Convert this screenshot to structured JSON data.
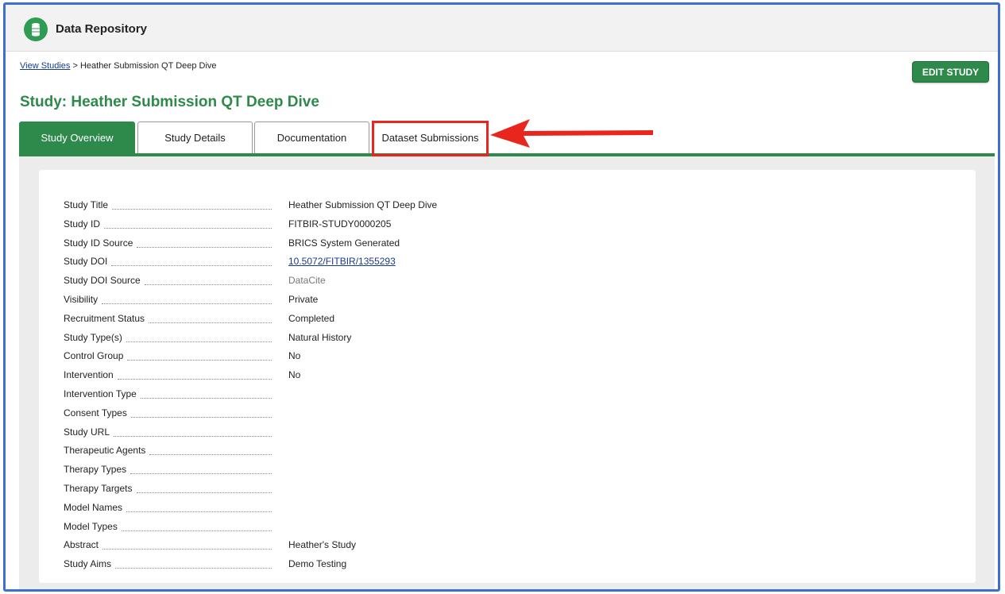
{
  "app": {
    "title": "Data Repository"
  },
  "breadcrumb": {
    "link": "View Studies",
    "separator": ">",
    "current": "Heather Submission QT Deep Dive"
  },
  "actions": {
    "edit_label": "EDIT STUDY"
  },
  "page": {
    "title": "Study: Heather Submission QT Deep Dive"
  },
  "tabs": [
    {
      "label": "Study Overview",
      "active": true
    },
    {
      "label": "Study Details",
      "active": false
    },
    {
      "label": "Documentation",
      "active": false
    },
    {
      "label": "Dataset Submissions",
      "active": false
    }
  ],
  "annotation": {
    "highlight_color": "#e8261d",
    "target": "Dataset Submissions"
  },
  "colors": {
    "accent": "#2e8a4b",
    "link": "#1a3a8a",
    "frame": "#3d6fd1"
  },
  "fields": [
    {
      "label": "Study Title",
      "value": "Heather Submission QT Deep Dive"
    },
    {
      "label": "Study ID",
      "value": "FITBIR-STUDY0000205"
    },
    {
      "label": "Study ID Source",
      "value": "BRICS System Generated"
    },
    {
      "label": "Study DOI",
      "value": "10.5072/FITBIR/1355293"
    },
    {
      "label": "Study DOI Source",
      "value": "DataCite"
    },
    {
      "label": "Visibility",
      "value": "Private"
    },
    {
      "label": "Recruitment Status",
      "value": "Completed"
    },
    {
      "label": "Study Type(s)",
      "value": "Natural History"
    },
    {
      "label": "Control Group",
      "value": "No"
    },
    {
      "label": "Intervention",
      "value": "No"
    },
    {
      "label": "Intervention Type",
      "value": ""
    },
    {
      "label": "Consent Types",
      "value": ""
    },
    {
      "label": "Study URL",
      "value": ""
    },
    {
      "label": "Therapeutic Agents",
      "value": ""
    },
    {
      "label": "Therapy Types",
      "value": ""
    },
    {
      "label": "Therapy Targets",
      "value": ""
    },
    {
      "label": "Model Names",
      "value": ""
    },
    {
      "label": "Model Types",
      "value": ""
    },
    {
      "label": "Abstract",
      "value": "Heather's Study"
    },
    {
      "label": "Study Aims",
      "value": "Demo Testing"
    }
  ]
}
